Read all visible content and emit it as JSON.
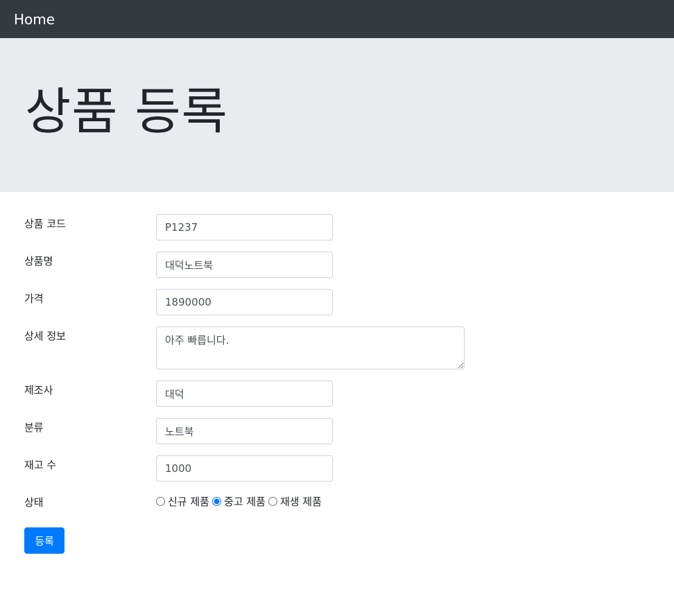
{
  "navbar": {
    "brand": "Home"
  },
  "header": {
    "title": "상품 등록"
  },
  "form": {
    "product_code": {
      "label": "상품 코드",
      "value": "P1237"
    },
    "product_name": {
      "label": "상품명",
      "value": "대덕노트북"
    },
    "price": {
      "label": "가격",
      "value": "1890000"
    },
    "description": {
      "label": "상세 정보",
      "value": "아주 빠릅니다."
    },
    "manufacturer": {
      "label": "제조사",
      "value": "대덕"
    },
    "category": {
      "label": "분류",
      "value": "노트북"
    },
    "stock": {
      "label": "재고 수",
      "value": "1000"
    },
    "condition": {
      "label": "상태",
      "options": [
        "신규 제품",
        "중고 제품",
        "재생 제품"
      ],
      "selected": "중고 제품"
    },
    "submit_label": "등록"
  }
}
